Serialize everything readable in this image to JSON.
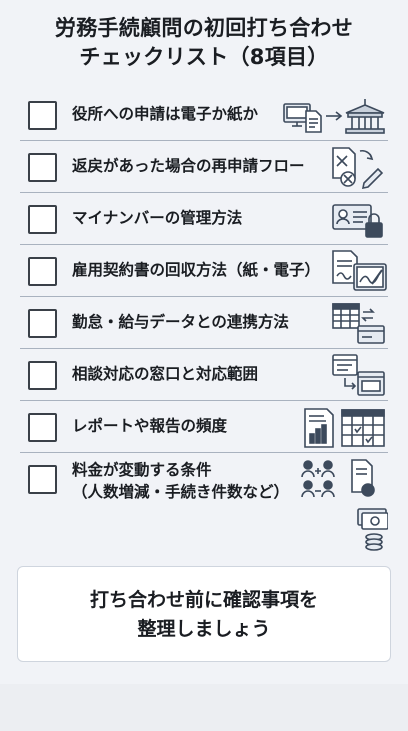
{
  "title": {
    "line1": "労務手続顧問の初回打ち合わせ",
    "line2": "チェックリスト（8項目）"
  },
  "items": [
    {
      "label": "役所への申請は電子か紙か",
      "checked": false,
      "icons": [
        "computer-document-icon",
        "arrow-right-icon",
        "government-building-icon"
      ]
    },
    {
      "label": "返戻があった場合の再申請フロー",
      "checked": false,
      "icons": [
        "rejected-document-icon",
        "cycle-arrow-icon",
        "pen-icon"
      ]
    },
    {
      "label": "マイナンバーの管理方法",
      "checked": false,
      "icons": [
        "id-card-icon",
        "lock-icon"
      ]
    },
    {
      "label": "雇用契約書の回収方法（紙・電子）",
      "checked": false,
      "icons": [
        "paper-contract-icon",
        "tablet-signature-icon"
      ]
    },
    {
      "label": "勤怠・給与データとの連携方法",
      "checked": false,
      "icons": [
        "calendar-icon",
        "sync-arrows-icon",
        "card-icon"
      ]
    },
    {
      "label": "相談対応の窓口と対応範囲",
      "checked": false,
      "icons": [
        "chat-window-icon",
        "arrow-icon",
        "window-icon"
      ]
    },
    {
      "label": "レポートや報告の頻度",
      "checked": false,
      "icons": [
        "report-chart-icon",
        "calendar-icon"
      ]
    },
    {
      "label_line1": "料金が変動する条件",
      "label_line2": "（人数増減・手続き件数など）",
      "checked": false,
      "icons": [
        "people-plus-minus-icon",
        "fee-document-icon",
        "cash-coins-icon"
      ]
    }
  ],
  "cta": {
    "line1": "打ち合わせ前に確認事項を",
    "line2": "整理しましょう"
  },
  "colors": {
    "background": "#f1f3f7",
    "divider": "#a9b2bf",
    "text": "#1a1d22",
    "icon": "#3d4a5c"
  }
}
